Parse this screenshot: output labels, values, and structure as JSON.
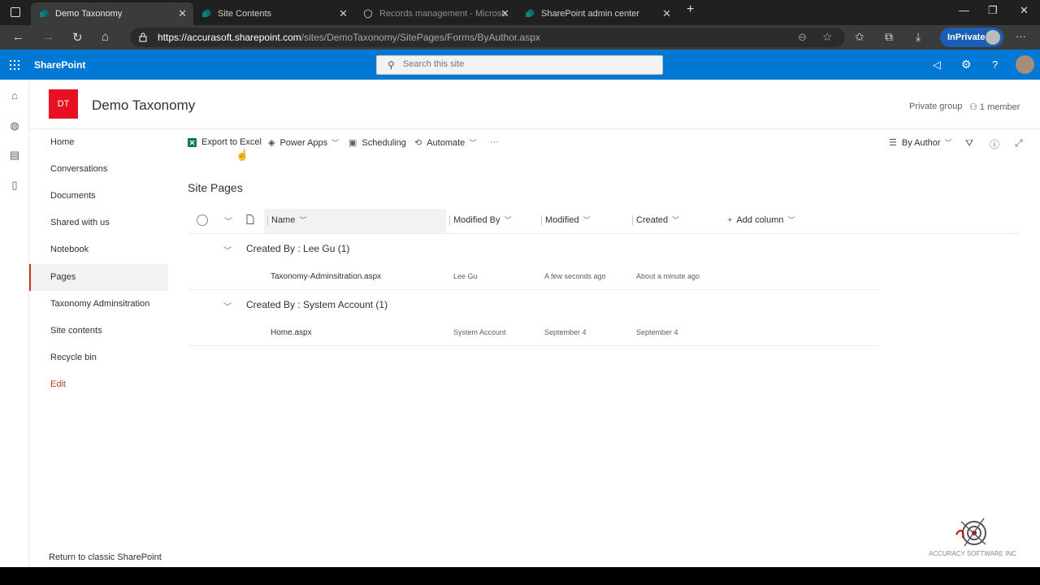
{
  "browser": {
    "tabs": [
      {
        "label": "Demo Taxonomy",
        "state": "active"
      },
      {
        "label": "Site Contents",
        "state": "inactive"
      },
      {
        "label": "Records management - Microso",
        "state": "dim"
      },
      {
        "label": "SharePoint admin center",
        "state": "inactive"
      }
    ],
    "url_host": "https://accurasoft.sharepoint.com",
    "url_path": "/sites/DemoTaxonomy/SitePages/Forms/ByAuthor.aspx",
    "inprivate_label": "InPrivate"
  },
  "suite": {
    "brand": "SharePoint",
    "search_placeholder": "Search this site"
  },
  "site": {
    "logo_initials": "DT",
    "title": "Demo Taxonomy",
    "group_type": "Private group",
    "members": "1 member"
  },
  "nav": {
    "items": [
      "Home",
      "Conversations",
      "Documents",
      "Shared with us",
      "Notebook",
      "Pages",
      "Taxonomy Adminsitration",
      "Site contents",
      "Recycle bin"
    ],
    "selected": "Pages",
    "edit_label": "Edit",
    "footer": "Return to classic SharePoint"
  },
  "commands": {
    "export": "Export to Excel",
    "power_apps": "Power Apps",
    "scheduling": "Scheduling",
    "automate": "Automate",
    "more": "···",
    "view": "By Author"
  },
  "list": {
    "title": "Site Pages",
    "columns": {
      "name": "Name",
      "modified_by": "Modified By",
      "modified": "Modified",
      "created": "Created",
      "add": "Add column"
    },
    "groups": [
      {
        "label": "Created By : Lee Gu (1)",
        "rows": [
          {
            "name": "Taxonomy-Adminsitration.aspx",
            "modified_by": "Lee Gu",
            "modified": "A few seconds ago",
            "created": "About a minute ago"
          }
        ]
      },
      {
        "label": "Created By : System Account (1)",
        "rows": [
          {
            "name": "Home.aspx",
            "modified_by": "System Account",
            "modified": "September 4",
            "created": "September 4"
          }
        ]
      }
    ]
  },
  "watermark": "ACCURACY SOFTWARE INC",
  "colors": {
    "suite_bar": "#0078d4",
    "site_logo": "#e81123",
    "nav_accent": "#c43b1d",
    "excel": "#107c41"
  }
}
